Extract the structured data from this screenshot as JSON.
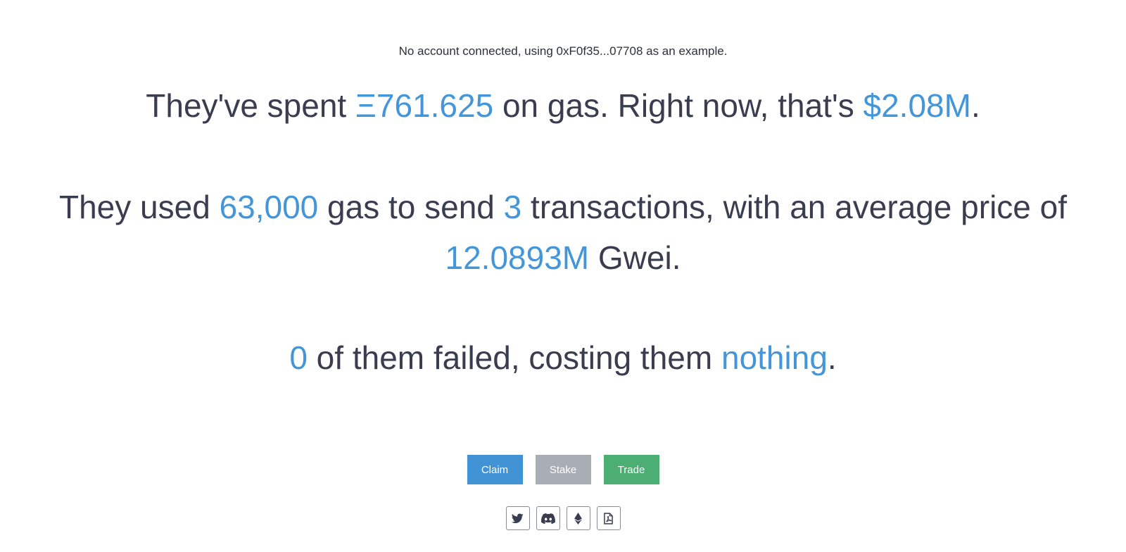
{
  "notice": {
    "text": "No account connected, using 0xF0f35...07708 as an example."
  },
  "summary": {
    "line1": {
      "prefix": "They've spent ",
      "eth_spent": "Ξ761.625",
      "middle": " on gas. Right now, that's ",
      "usd_value": "$2.08M",
      "suffix": "."
    },
    "line2": {
      "prefix": "They used ",
      "gas_used": "63,000",
      "middle": " gas to send ",
      "tx_count": "3",
      "suffix": " transactions, with an average price of"
    },
    "line3": {
      "avg_price": "12.0893M",
      "suffix": " Gwei."
    },
    "line4": {
      "failed_count": "0",
      "middle": " of them failed, costing them ",
      "failed_cost": "nothing",
      "suffix": "."
    }
  },
  "actions": {
    "claim_label": "Claim",
    "stake_label": "Stake",
    "trade_label": "Trade"
  },
  "links": [
    {
      "icon": "twitter-icon"
    },
    {
      "icon": "discord-icon"
    },
    {
      "icon": "ethereum-icon"
    },
    {
      "icon": "pdf-file-icon"
    }
  ],
  "colors": {
    "text": "#3a3d4f",
    "highlight": "#4496d8",
    "claim": "#4292d6",
    "stake": "#a9adb6",
    "trade": "#4dae74"
  }
}
